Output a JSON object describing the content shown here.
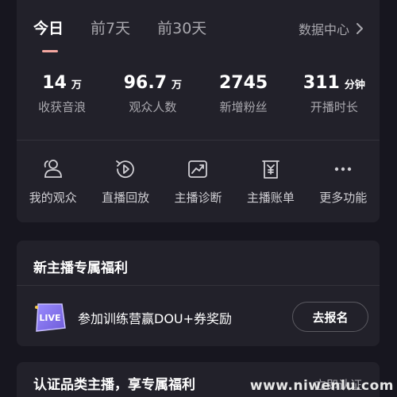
{
  "tabs": [
    {
      "label": "今日",
      "active": true
    },
    {
      "label": "前7天",
      "active": false
    },
    {
      "label": "前30天",
      "active": false
    }
  ],
  "data_center": {
    "label": "数据中心",
    "icon": "chevron-right-icon"
  },
  "metrics": [
    {
      "value": "14",
      "unit": "万",
      "label": "收获音浪"
    },
    {
      "value": "96.7",
      "unit": "万",
      "label": "观众人数"
    },
    {
      "value": "2745",
      "unit": "",
      "label": "新增粉丝"
    },
    {
      "value": "311",
      "unit": "分钟",
      "label": "开播时长"
    }
  ],
  "tools": [
    {
      "label": "我的观众",
      "icon": "audience-icon"
    },
    {
      "label": "直播回放",
      "icon": "replay-icon"
    },
    {
      "label": "主播诊断",
      "icon": "diagnosis-icon"
    },
    {
      "label": "主播账单",
      "icon": "bill-icon"
    },
    {
      "label": "更多功能",
      "icon": "more-icon"
    }
  ],
  "promo": {
    "title": "新主播专属福利",
    "badge_text": "LIVE",
    "text": "参加训练营赢DOU+券奖励",
    "button": "去报名"
  },
  "cert": {
    "title": "认证品类主播，享专属福利",
    "link": "立即认证"
  },
  "watermark": "www.niwenlu.com",
  "colors": {
    "background": "#17161f",
    "card": "#22212a",
    "tab_indicator": "#f4a7a0",
    "muted_text": "#a9a8ae"
  }
}
